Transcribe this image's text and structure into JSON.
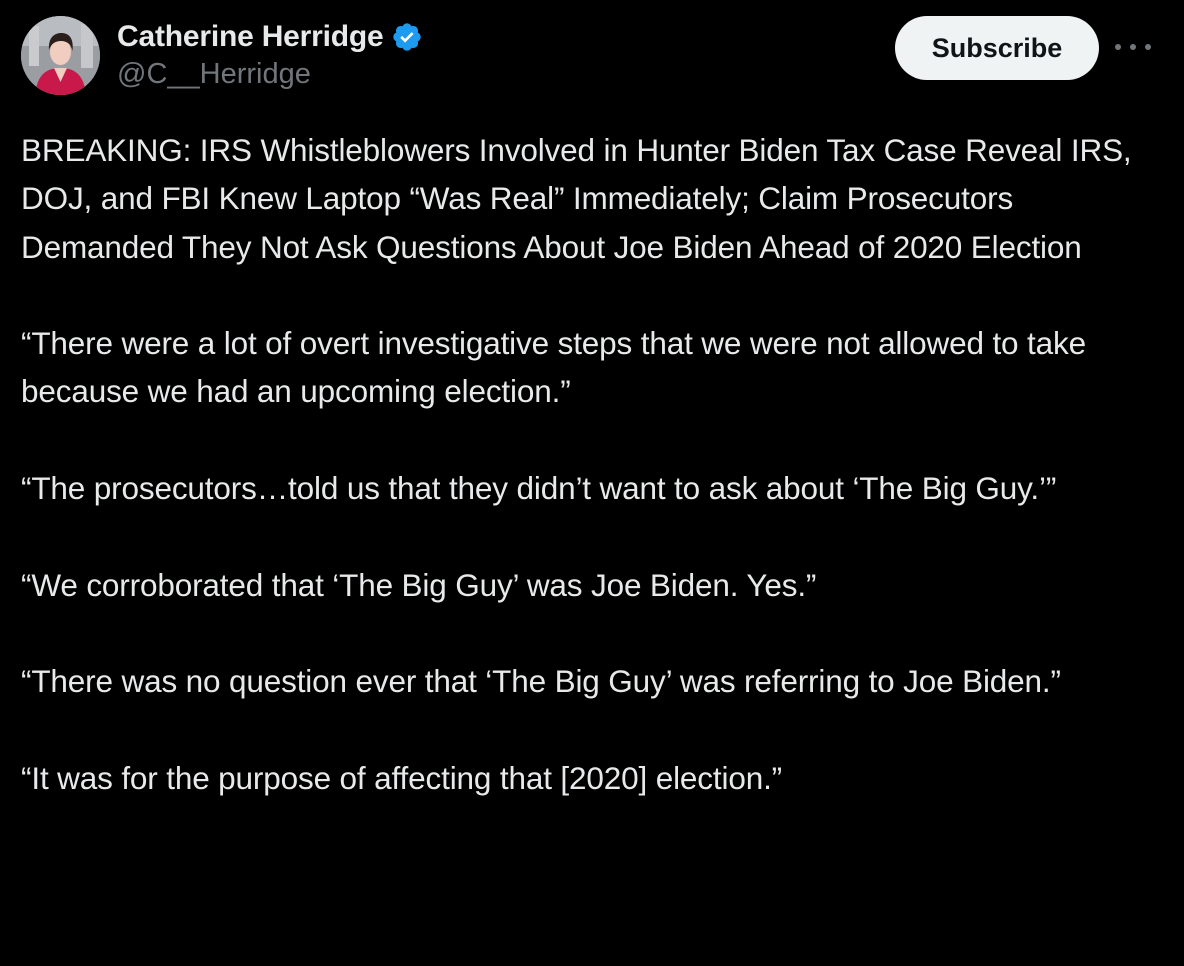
{
  "author": {
    "display_name": "Catherine Herridge",
    "handle": "@C__Herridge",
    "verified_icon": "verified-badge-icon",
    "verified_color": "#1d9bf0"
  },
  "actions": {
    "subscribe_label": "Subscribe",
    "more_icon": "more-horizontal-icon"
  },
  "tweet": {
    "paragraphs": [
      "BREAKING: IRS Whistleblowers Involved in Hunter Biden Tax Case Reveal IRS, DOJ, and FBI Knew Laptop “Was Real” Immediately; Claim Prosecutors Demanded They Not Ask Questions About Joe Biden Ahead of 2020 Election",
      "“There were a lot of overt investigative steps that we were not allowed to take because we had an upcoming election.”",
      "“The prosecutors…told us that they didn’t want to ask about ‘The Big Guy.’”",
      "“We corroborated that ‘The Big Guy’ was Joe Biden. Yes.”",
      "“There was no question ever that ‘The Big Guy’ was referring to Joe Biden.”",
      "“It was for the purpose of affecting that [2020] election.”"
    ]
  },
  "theme": {
    "background": "#000000",
    "text": "#e7e9ea",
    "secondary_text": "#71767b",
    "button_bg": "#eff3f4"
  }
}
